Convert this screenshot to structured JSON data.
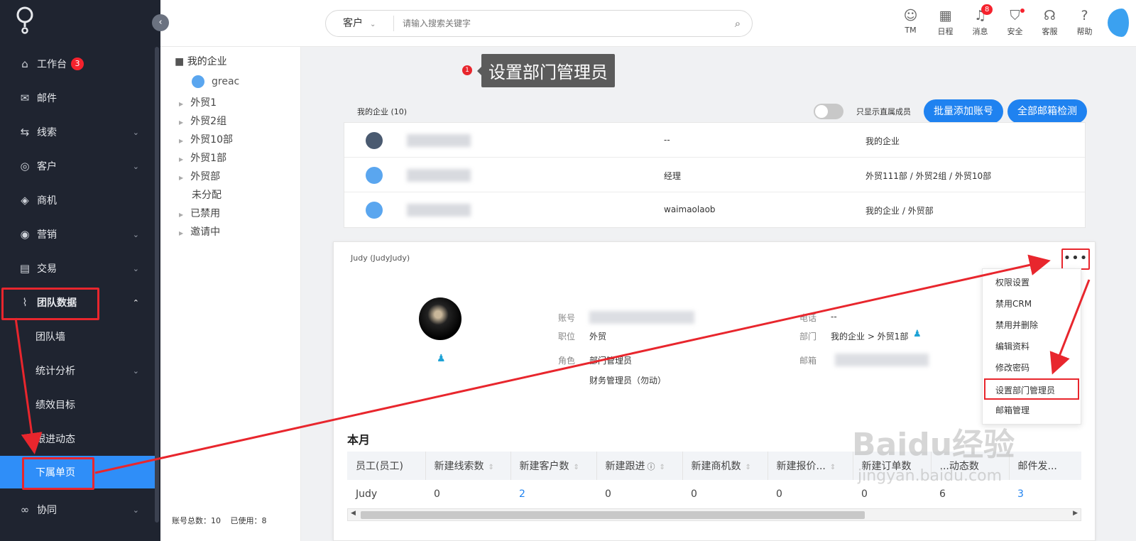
{
  "sidebar": {
    "items": [
      {
        "label": "工作台",
        "icon": "home-icon",
        "badge": "3"
      },
      {
        "label": "邮件",
        "icon": "mail-icon"
      },
      {
        "label": "线索",
        "icon": "lead-icon",
        "expandable": true
      },
      {
        "label": "客户",
        "icon": "customer-icon",
        "expandable": true
      },
      {
        "label": "商机",
        "icon": "opportunity-icon"
      },
      {
        "label": "营销",
        "icon": "marketing-icon",
        "expandable": true
      },
      {
        "label": "交易",
        "icon": "deal-icon",
        "expandable": true
      },
      {
        "label": "团队数据",
        "icon": "chart-icon",
        "expanded": true
      }
    ],
    "subitems": [
      {
        "label": "团队墙"
      },
      {
        "label": "统计分析",
        "expandable": true
      },
      {
        "label": "绩效目标"
      },
      {
        "label": "跟进动态"
      },
      {
        "label": "下属单页",
        "active": true
      }
    ],
    "bottom_item": {
      "label": "协同",
      "icon": "collab-icon"
    },
    "collapse_icon": "chevron-left-icon",
    "accent": "#2f8ef8"
  },
  "topbar": {
    "search_scope": "客户",
    "search_placeholder": "请输入搜索关键字",
    "tools": [
      {
        "label": "TM",
        "icon": "tm-icon"
      },
      {
        "label": "日程",
        "icon": "calendar-icon"
      },
      {
        "label": "消息",
        "icon": "bell-icon",
        "badge": "8"
      },
      {
        "label": "安全",
        "icon": "shield-icon",
        "dot": true
      },
      {
        "label": "客服",
        "icon": "headset-icon"
      },
      {
        "label": "帮助",
        "icon": "help-icon"
      }
    ]
  },
  "tree": {
    "root": "我的企业",
    "user": "greac",
    "nodes": [
      "外贸1",
      "外贸2组",
      "外贸10部",
      "外贸1部",
      "外贸部",
      "未分配",
      "已禁用",
      "邀请中"
    ],
    "footer_total": "账号总数：10",
    "footer_used": "已使用：8"
  },
  "tooltip": {
    "step": "1",
    "text": "设置部门管理员"
  },
  "list": {
    "title": "我的企业 (10)",
    "toggle_label": "只显示直属成员",
    "btn_batch_add": "批量添加账号",
    "btn_check_all": "全部邮箱检测",
    "rows": [
      {
        "position": "--",
        "dept": "我的企业"
      },
      {
        "position": "经理",
        "dept": "外贸111部 / 外贸2组 / 外贸10部"
      },
      {
        "position": "waimaolaob",
        "dept": "我的企业 / 外贸部"
      }
    ]
  },
  "detail": {
    "name": "Judy (JudyJudy)",
    "more": "•••",
    "labels": {
      "account": "账号",
      "title": "职位",
      "role": "角色",
      "phone": "电话",
      "dept": "部门",
      "email": "邮箱"
    },
    "title_val": "外贸",
    "role_val1": "部门管理员",
    "role_val2": "财务管理员（勿动）",
    "phone_val": "--",
    "dept_val": "我的企业 > 外贸1部"
  },
  "dropdown": [
    "权限设置",
    "禁用CRM",
    "禁用并删除",
    "编辑资料",
    "修改密码",
    "设置部门管理员",
    "邮箱管理"
  ],
  "stats": {
    "title": "本月",
    "columns": [
      "员工(员工)",
      "新建线索数",
      "新建客户数",
      "新建跟进",
      "新建商机数",
      "新建报价...",
      "新建订单数",
      "...动态数",
      "邮件发..."
    ],
    "rows": [
      [
        "Judy",
        "0",
        "2",
        "0",
        "0",
        "0",
        "0",
        "6",
        "3"
      ]
    ]
  },
  "watermark": {
    "brand": "Baidu经验",
    "url": "jingyan.baidu.com"
  },
  "annotation_color": "#e8262d"
}
